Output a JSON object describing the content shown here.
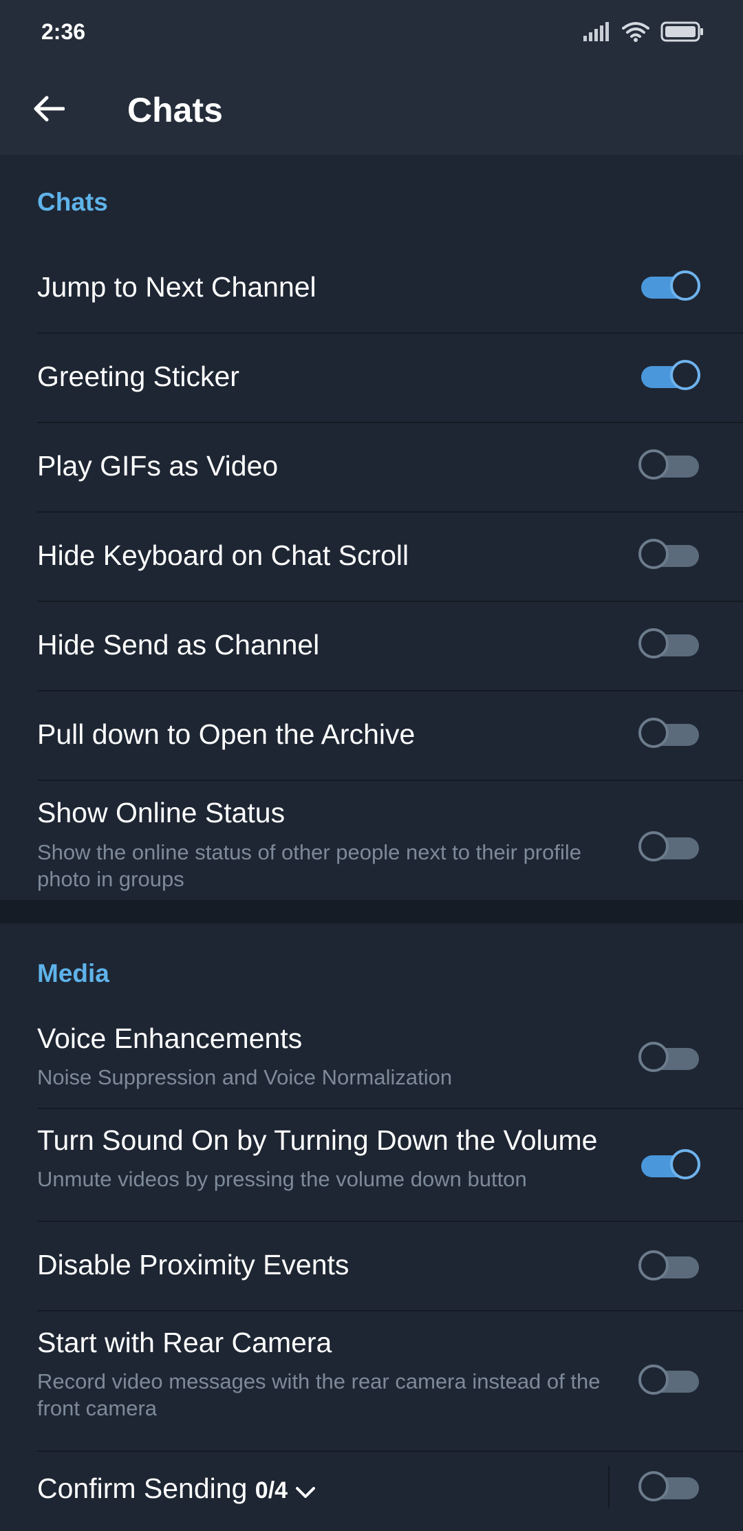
{
  "status_bar": {
    "time": "2:36"
  },
  "app_bar": {
    "title": "Chats"
  },
  "sections": {
    "chats": {
      "header": "Chats",
      "items": [
        {
          "title": "Jump to Next Channel",
          "enabled": true
        },
        {
          "title": "Greeting Sticker",
          "enabled": true
        },
        {
          "title": "Play GIFs as Video",
          "enabled": false
        },
        {
          "title": "Hide Keyboard on Chat Scroll",
          "enabled": false
        },
        {
          "title": "Hide Send as Channel",
          "enabled": false
        },
        {
          "title": "Pull down to Open the Archive",
          "enabled": false
        },
        {
          "title": "Show Online Status",
          "subtitle": "Show the online status of other people next to their profile photo in groups",
          "enabled": false
        }
      ]
    },
    "media": {
      "header": "Media",
      "items": [
        {
          "title": "Voice Enhancements",
          "subtitle": "Noise Suppression and Voice Normalization",
          "enabled": false
        },
        {
          "title": "Turn Sound On by Turning Down the Volume",
          "subtitle": "Unmute videos by pressing the volume down button",
          "enabled": true
        },
        {
          "title": "Disable Proximity Events",
          "enabled": false
        },
        {
          "title": "Start with Rear Camera",
          "subtitle": "Record video messages with the rear camera instead of the front camera",
          "enabled": false
        },
        {
          "title": "Confirm Sending",
          "count": "0/4",
          "enabled": false
        }
      ]
    }
  },
  "colors": {
    "background": "#1e2633",
    "header_bar": "#252d3a",
    "accent": "#5fb3ea",
    "toggle_on": "#4a97db",
    "toggle_off": "#5b6b7c",
    "subtitle": "#7e8a99"
  },
  "icons": {
    "back": "arrow-left-icon",
    "signal": "signal-icon",
    "wifi": "wifi-icon",
    "battery": "battery-icon",
    "expand": "chevron-down-icon"
  }
}
